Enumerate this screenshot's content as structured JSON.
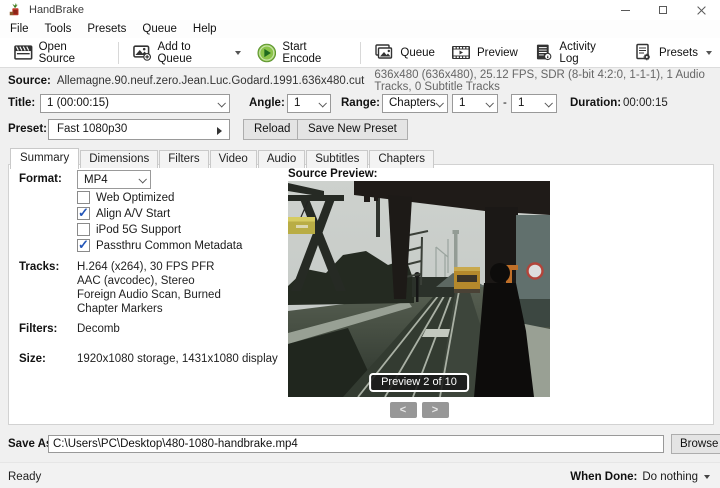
{
  "window": {
    "title": "HandBrake"
  },
  "menu": {
    "items": [
      "File",
      "Tools",
      "Presets",
      "Queue",
      "Help"
    ]
  },
  "toolbar": {
    "open_source": "Open Source",
    "add_to_queue": "Add to Queue",
    "start_encode": "Start Encode",
    "queue": "Queue",
    "preview": "Preview",
    "activity_log": "Activity Log",
    "presets": "Presets"
  },
  "source": {
    "label": "Source:",
    "filename": "Allemagne.90.neuf.zero.Jean.Luc.Godard.1991.636x480.cut",
    "details": "636x480 (636x480), 25.12 FPS, SDR (8-bit 4:2:0, 1-1-1), 1 Audio Tracks, 0 Subtitle Tracks"
  },
  "title_row": {
    "title_label": "Title:",
    "title_value": "1 (00:00:15)",
    "angle_label": "Angle:",
    "angle_value": "1",
    "range_label": "Range:",
    "range_type": "Chapters",
    "range_from": "1",
    "range_sep": "-",
    "range_to": "1",
    "duration_label": "Duration:",
    "duration_value": "00:00:15"
  },
  "preset_row": {
    "label": "Preset:",
    "value": "Fast 1080p30",
    "reload": "Reload",
    "save_new": "Save New Preset"
  },
  "tabs": {
    "items": [
      "Summary",
      "Dimensions",
      "Filters",
      "Video",
      "Audio",
      "Subtitles",
      "Chapters"
    ],
    "active": "Summary"
  },
  "summary": {
    "format_label": "Format:",
    "format_value": "MP4",
    "checkboxes": [
      {
        "label": "Web Optimized",
        "checked": false
      },
      {
        "label": "Align A/V Start",
        "checked": true
      },
      {
        "label": "iPod 5G Support",
        "checked": false
      },
      {
        "label": "Passthru Common Metadata",
        "checked": true
      }
    ],
    "tracks_label": "Tracks:",
    "tracks": [
      "H.264 (x264), 30 FPS PFR",
      "AAC (avcodec), Stereo",
      "Foreign Audio Scan, Burned",
      "Chapter Markers"
    ],
    "filters_label": "Filters:",
    "filters_value": "Decomb",
    "size_label": "Size:",
    "size_value": "1920x1080 storage, 1431x1080 display"
  },
  "preview": {
    "label": "Source Preview:",
    "badge": "Preview 2 of 10",
    "prev": "<",
    "next": ">"
  },
  "save_as": {
    "label": "Save As:",
    "value": "C:\\Users\\PC\\Desktop\\480-1080-handbrake.mp4",
    "browse": "Browse"
  },
  "status": {
    "left": "Ready",
    "when_done_label": "When Done:",
    "when_done_value": "Do nothing"
  },
  "icons": {
    "app": "handbrake-pineapple-icon",
    "open_source": "clapperboard-icon",
    "add_to_queue": "photo-add-icon",
    "start_encode": "green-play-icon",
    "queue": "photo-stack-icon",
    "preview": "filmstrip-icon",
    "activity_log": "log-document-icon",
    "presets": "document-gear-icon"
  },
  "colors": {
    "start_encode_green": "#8bc34a",
    "checkbox_check_blue": "#2456b8",
    "preview_badge_bg": "#191919"
  }
}
